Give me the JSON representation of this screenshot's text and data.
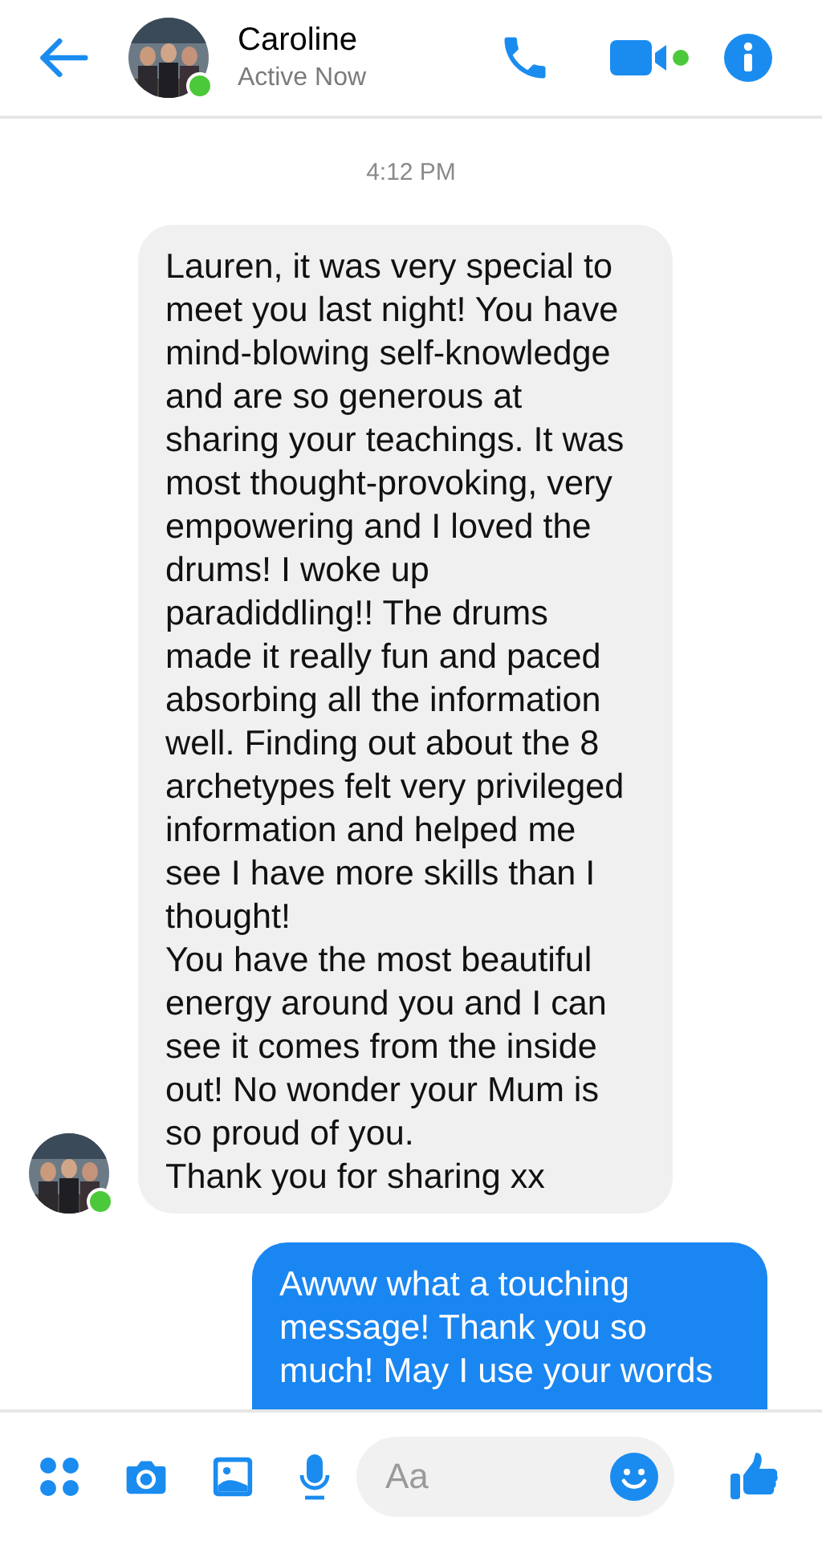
{
  "header": {
    "name": "Caroline",
    "status": "Active Now",
    "online": true,
    "video_active": true
  },
  "timestamp": "4:12 PM",
  "messages": [
    {
      "kind": "incoming",
      "text": "Lauren, it was very special to meet you last night! You have mind-blowing self-knowledge and are so generous at sharing your teachings. It was most thought-provoking, very empowering and I loved the drums! I woke up paradiddling!! The drums made it really fun and paced absorbing all the information well. Finding out about the 8 archetypes felt very privileged information and helped me see I have  more skills than I thought!\nYou have the most beautiful energy around you and I can see it comes from the inside out! No wonder your Mum is so proud of you.\nThank you for sharing xx",
      "online": true
    },
    {
      "kind": "outgoing",
      "text": "Awww what a touching message! Thank you so much! May I use your words"
    }
  ],
  "composer": {
    "placeholder": "Aa"
  }
}
